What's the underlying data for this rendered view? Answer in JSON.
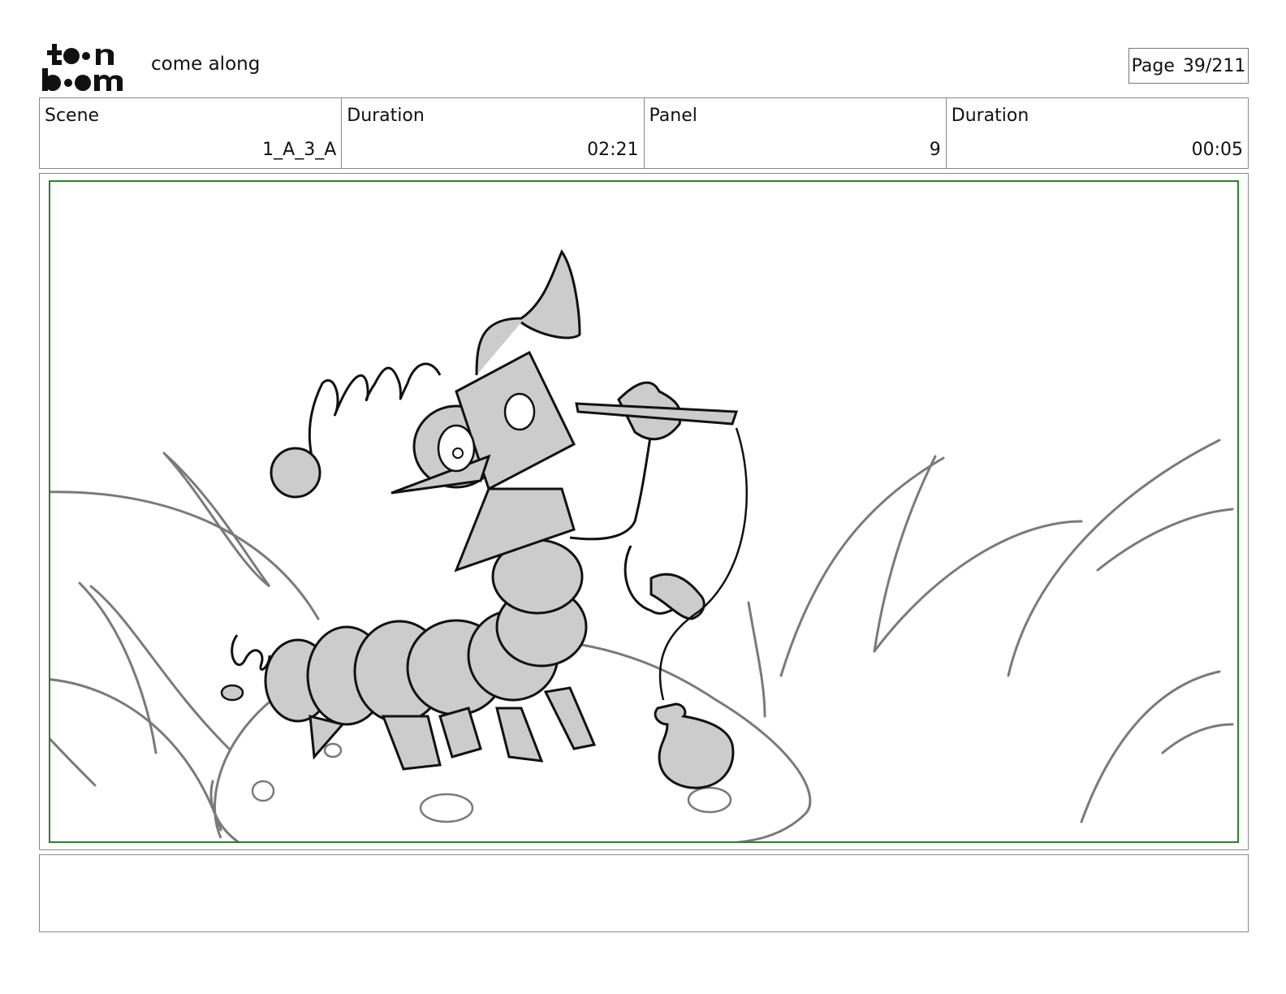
{
  "header": {
    "logo_text": "toon boom",
    "project_title": "come along",
    "page_label": "Page",
    "page_number": "39/211"
  },
  "info": {
    "scene_label": "Scene",
    "scene_value": "1_A_3_A",
    "scene_duration_label": "Duration",
    "scene_duration_value": "02:21",
    "panel_label": "Panel",
    "panel_value": "9",
    "panel_duration_label": "Duration",
    "panel_duration_value": "00:05"
  },
  "panel": {
    "frame_color": "#2e7d32",
    "sketch_fill": "#cccccc",
    "grass_color": "#7a7a7a"
  },
  "notes": {
    "text": ""
  }
}
